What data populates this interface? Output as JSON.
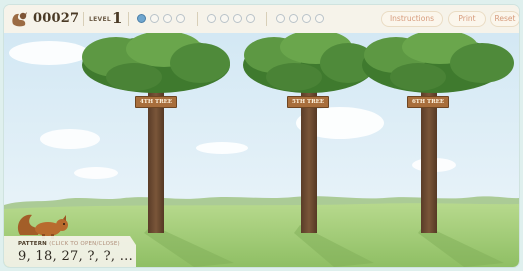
{
  "header": {
    "score": "00027",
    "level_label": "LEVEL",
    "level_value": "1",
    "progress_groups": [
      {
        "filled": [
          true,
          false,
          false,
          false
        ]
      },
      {
        "filled": [
          false,
          false,
          false,
          false
        ]
      },
      {
        "filled": [
          false,
          false,
          false,
          false
        ]
      }
    ],
    "buttons": {
      "instructions": "Instructions",
      "print": "Print",
      "reset": "Reset"
    }
  },
  "trees": [
    {
      "sign": "4TH TREE"
    },
    {
      "sign": "5TH TREE"
    },
    {
      "sign": "6TH TREE"
    }
  ],
  "pattern": {
    "label": "PATTERN",
    "hint": "(CLICK TO OPEN/CLOSE)",
    "sequence": "9, 18, 27, ?, ?, ..."
  },
  "colors": {
    "sky_top": "#d9ecf6",
    "grass": "#a8cf7e",
    "trunk": "#6b4a33",
    "foliage": "#4f8a3a",
    "sign": "#a86e3c"
  }
}
